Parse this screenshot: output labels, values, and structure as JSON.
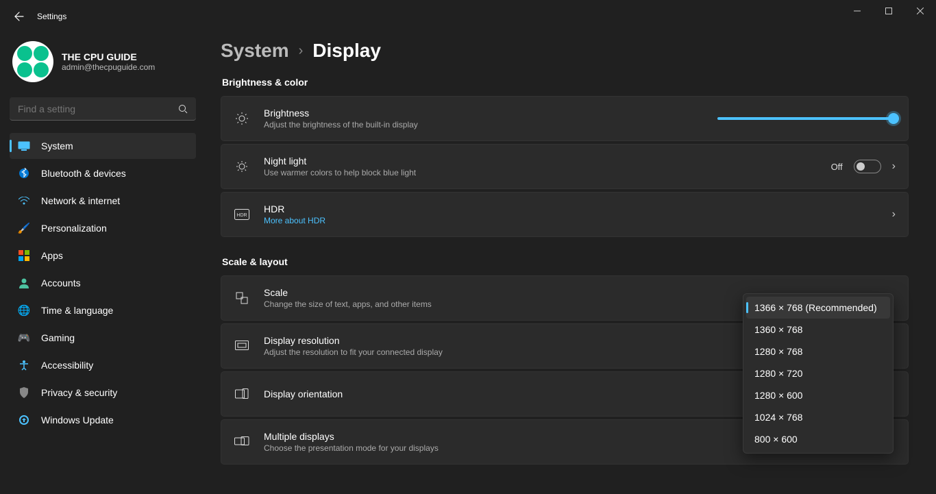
{
  "window": {
    "title": "Settings"
  },
  "profile": {
    "name": "THE CPU GUIDE",
    "email": "admin@thecpuguide.com"
  },
  "search": {
    "placeholder": "Find a setting"
  },
  "nav": [
    {
      "label": "System",
      "active": true
    },
    {
      "label": "Bluetooth & devices"
    },
    {
      "label": "Network & internet"
    },
    {
      "label": "Personalization"
    },
    {
      "label": "Apps"
    },
    {
      "label": "Accounts"
    },
    {
      "label": "Time & language"
    },
    {
      "label": "Gaming"
    },
    {
      "label": "Accessibility"
    },
    {
      "label": "Privacy & security"
    },
    {
      "label": "Windows Update"
    }
  ],
  "breadcrumb": {
    "parent": "System",
    "current": "Display"
  },
  "sections": {
    "brightness_color": "Brightness & color",
    "scale_layout": "Scale & layout"
  },
  "cards": {
    "brightness": {
      "title": "Brightness",
      "sub": "Adjust the brightness of the built-in display"
    },
    "nightlight": {
      "title": "Night light",
      "sub": "Use warmer colors to help block blue light",
      "state": "Off"
    },
    "hdr": {
      "title": "HDR",
      "link": "More about HDR"
    },
    "scale": {
      "title": "Scale",
      "sub": "Change the size of text, apps, and other items"
    },
    "resolution": {
      "title": "Display resolution",
      "sub": "Adjust the resolution to fit your connected display"
    },
    "orientation": {
      "title": "Display orientation"
    },
    "multiple": {
      "title": "Multiple displays",
      "sub": "Choose the presentation mode for your displays"
    }
  },
  "resolution_dropdown": {
    "options": [
      "1366 × 768 (Recommended)",
      "1360 × 768",
      "1280 × 768",
      "1280 × 720",
      "1280 × 600",
      "1024 × 768",
      "800 × 600"
    ],
    "selected_index": 0
  }
}
